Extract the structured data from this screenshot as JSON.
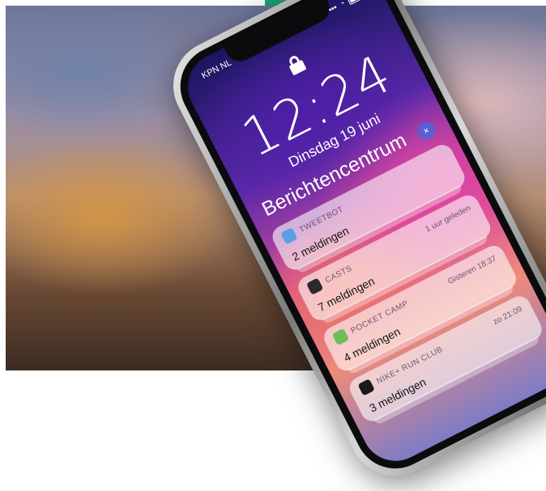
{
  "carrier": "KPN NL",
  "time": "12:24",
  "date": "Dinsdag 19 juni",
  "notification_center_title": "Berichtencentrum",
  "clear_button": "×",
  "notifications": [
    {
      "app": "TWEETBOT",
      "time": "",
      "count": "2 meldingen",
      "icon": "tweetbot-icon",
      "icon_color": "#5aa0e8"
    },
    {
      "app": "CASTS",
      "time": "1 uur geleden",
      "count": "7 meldingen",
      "icon": "casts-icon",
      "icon_color": "#2a2a2a"
    },
    {
      "app": "POCKET CAMP",
      "time": "Gisteren 18:37",
      "count": "4 meldingen",
      "icon": "pocket-camp-icon",
      "icon_color": "#6bbf59"
    },
    {
      "app": "NIKE+ RUN CLUB",
      "time": "zo 21:09",
      "count": "3 meldingen",
      "icon": "nike-run-club-icon",
      "icon_color": "#1a1a1a"
    }
  ],
  "colors": {
    "accent_tab": "#1fa37a",
    "clear_button": "#5064dc"
  }
}
